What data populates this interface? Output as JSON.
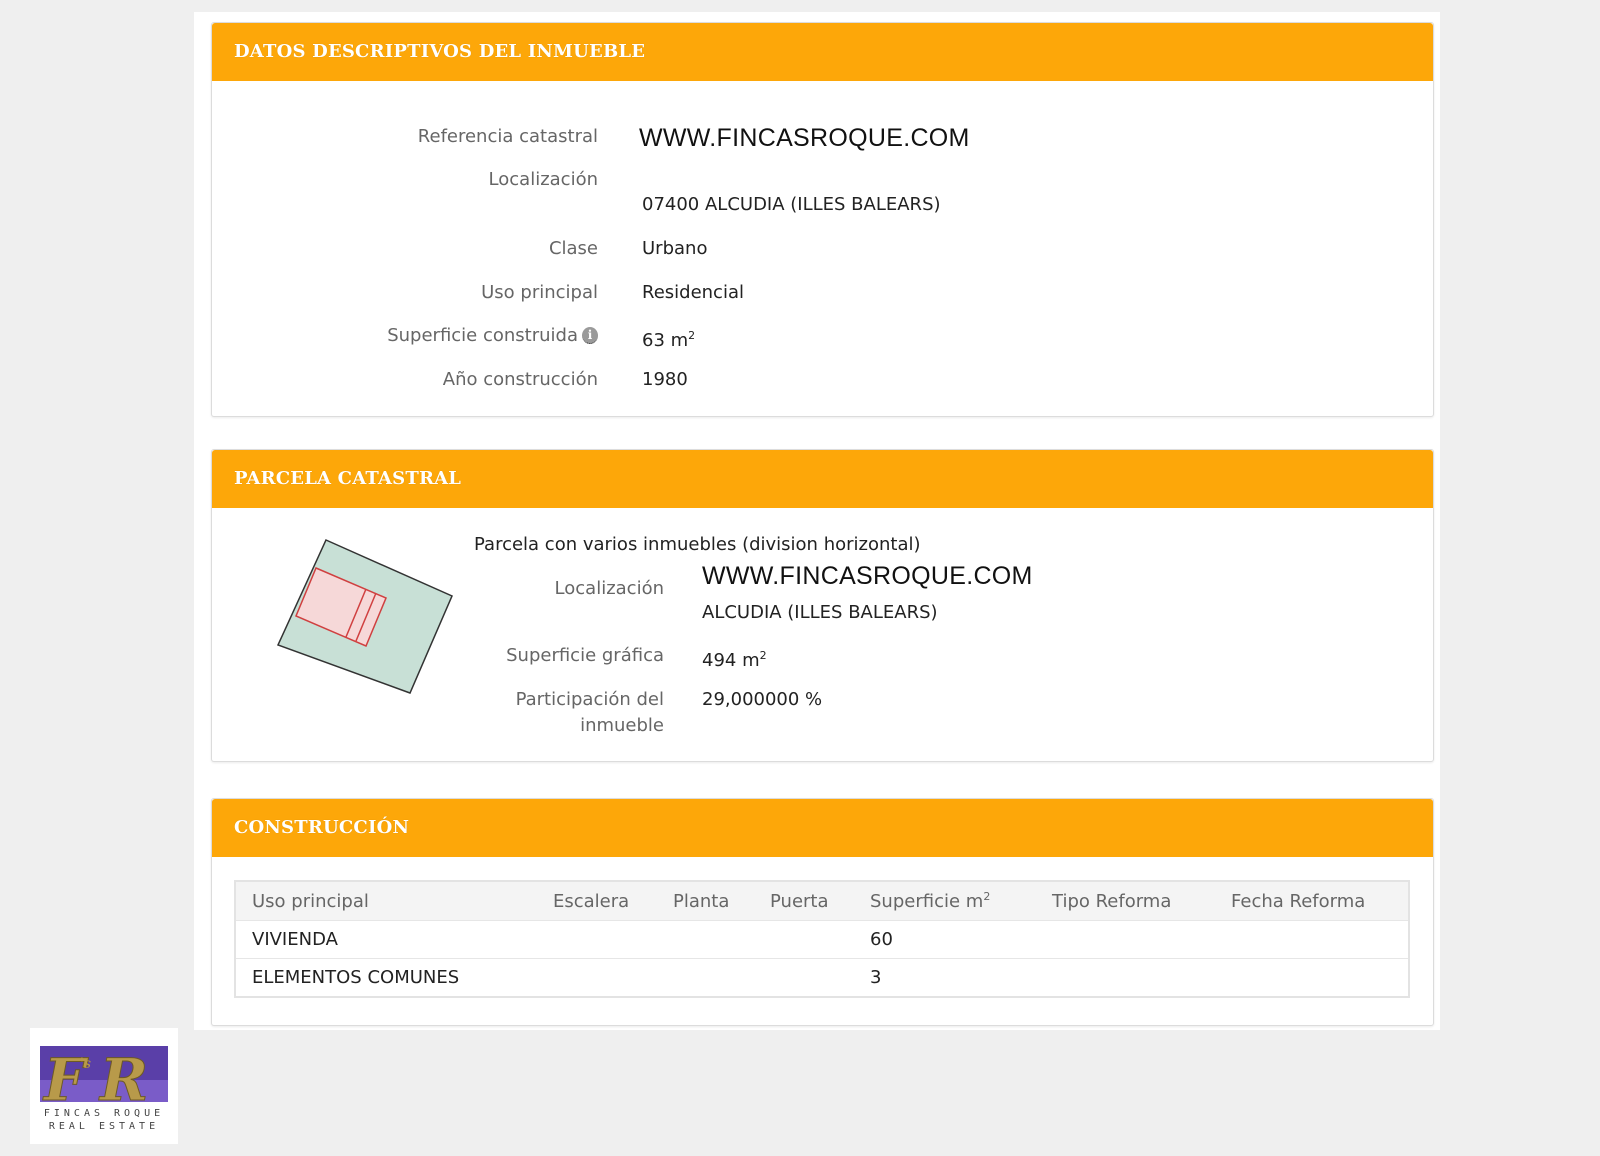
{
  "inmueble": {
    "header": "DATOS DESCRIPTIVOS DEL INMUEBLE",
    "ref_label": "Referencia catastral",
    "ref_value": "WWW.FINCASROQUE.COM",
    "loc_label": "Localización",
    "loc_value": "07400 ALCUDIA (ILLES BALEARS)",
    "clase_label": "Clase",
    "clase_value": "Urbano",
    "uso_label": "Uso principal",
    "uso_value": "Residencial",
    "sup_label": "Superficie construida",
    "sup_value": "63 m",
    "sup_unit_exp": "2",
    "ano_label": "Año construcción",
    "ano_value": "1980"
  },
  "parcela": {
    "header": "PARCELA CATASTRAL",
    "subtitle": "Parcela con varios inmuebles (division horizontal)",
    "loc_label": "Localización",
    "loc_value_1": "WWW.FINCASROQUE.COM",
    "loc_value_2": "ALCUDIA (ILLES BALEARS)",
    "sup_label": "Superficie gráfica",
    "sup_value": "494 m",
    "sup_unit_exp": "2",
    "part_label_1": "Participación del",
    "part_label_2": "inmueble",
    "part_value": "29,000000 %"
  },
  "construccion": {
    "header": "CONSTRUCCIÓN",
    "columns": [
      "Uso principal",
      "Escalera",
      "Planta",
      "Puerta",
      "Superficie m",
      "Tipo Reforma",
      "Fecha Reforma"
    ],
    "sup_col_exp": "2",
    "rows": [
      [
        "VIVIENDA",
        "",
        "",
        "",
        "60",
        "",
        ""
      ],
      [
        "ELEMENTOS COMUNES",
        "",
        "",
        "",
        "3",
        "",
        ""
      ]
    ]
  },
  "logo": {
    "text_1": "FINCAS ROQUE",
    "text_2": "REAL ESTATE",
    "colors": {
      "purple": "#5a3fa8",
      "gold": "#b89a4a"
    }
  }
}
